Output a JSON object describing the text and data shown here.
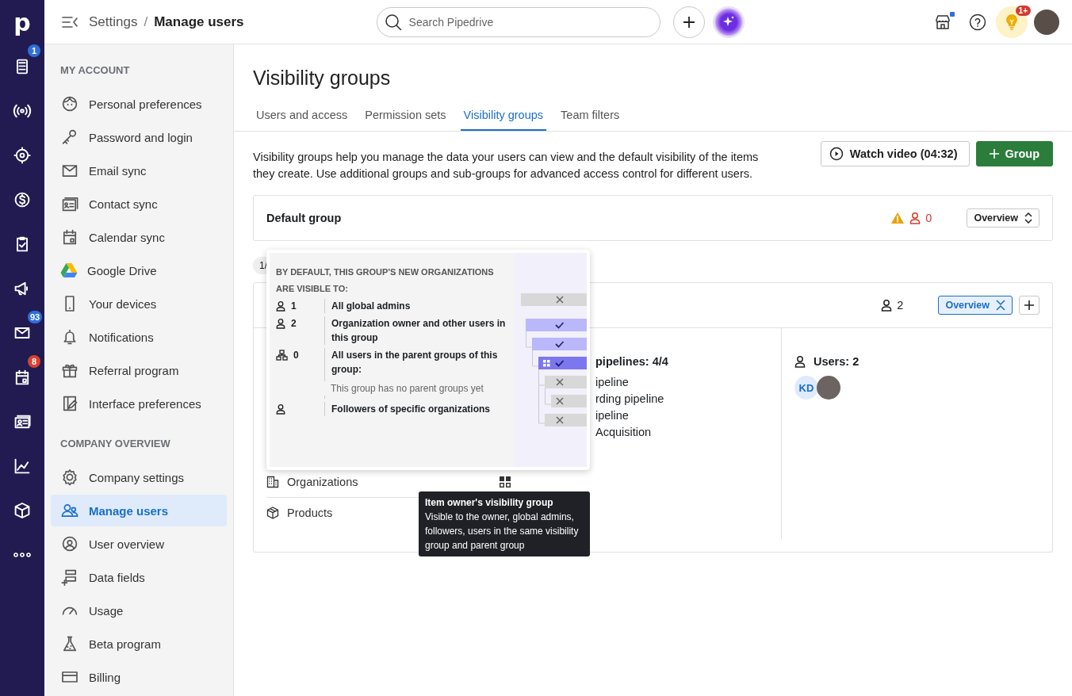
{
  "nav_rail": {
    "logo": "p",
    "badges": [
      {
        "text": "1",
        "color": "#2f6fdb"
      },
      {
        "text": "93",
        "color": "#2f6fdb"
      },
      {
        "text": "8",
        "color": "#d9412f"
      }
    ]
  },
  "topbar": {
    "breadcrumb": "Settings",
    "separator": "/",
    "page": "Manage users",
    "search": {
      "placeholder": "Search Pipedrive"
    },
    "tips_badge": "1+"
  },
  "sidebar": {
    "sections": [
      {
        "title": "MY ACCOUNT",
        "items": [
          {
            "label": "Personal preferences",
            "selected": false
          },
          {
            "label": "Password and login",
            "selected": false
          },
          {
            "label": "Email sync",
            "selected": false
          },
          {
            "label": "Contact sync",
            "selected": false
          },
          {
            "label": "Calendar sync",
            "selected": false
          },
          {
            "label": "Google Drive",
            "selected": false
          },
          {
            "label": "Your devices",
            "selected": false
          },
          {
            "label": "Notifications",
            "selected": false
          },
          {
            "label": "Referral program",
            "selected": false
          },
          {
            "label": "Interface preferences",
            "selected": false
          }
        ]
      },
      {
        "title": "COMPANY OVERVIEW",
        "items": [
          {
            "label": "Company settings",
            "selected": false
          },
          {
            "label": "Manage users",
            "selected": true
          },
          {
            "label": "User overview",
            "selected": false
          },
          {
            "label": "Data fields",
            "selected": false
          },
          {
            "label": "Usage",
            "selected": false
          },
          {
            "label": "Beta program",
            "selected": false
          },
          {
            "label": "Billing",
            "selected": false
          }
        ]
      }
    ]
  },
  "title": "Visibility groups",
  "tabs": [
    {
      "label": "Users and access",
      "selected": false
    },
    {
      "label": "Permission sets",
      "selected": false
    },
    {
      "label": "Visibility groups",
      "selected": true
    },
    {
      "label": "Team filters",
      "selected": false
    }
  ],
  "description": "Visibility groups help you manage the data your users can view and the default visibility of the items they create. Use additional groups and sub-groups for advanced access control for different users.",
  "buttons": {
    "video": "Watch video (04:32)",
    "add_group": "Group"
  },
  "groups": [
    {
      "name": "Default group",
      "warning": true,
      "users": "0",
      "view": "Overview",
      "expanded": false
    },
    {
      "warning": false,
      "users": "2",
      "view": "Overview",
      "expanded": true
    }
  ],
  "level_tag": "1/",
  "entities": [
    {
      "label": "Organizations",
      "kind": "building",
      "owner_group_icon": true
    },
    {
      "label": "Products",
      "kind": "box",
      "owner_group_icon": false
    }
  ],
  "pipelines": {
    "heading": "pipelines: 4/4",
    "items": [
      "ipeline",
      "rding pipeline",
      "ipeline",
      "Acquisition"
    ]
  },
  "users": {
    "heading": "Users: 2",
    "avatars": [
      {
        "kind": "initials",
        "initials": "KD"
      },
      {
        "kind": "photo"
      }
    ]
  },
  "popover": {
    "heading": "BY DEFAULT, THIS GROUP'S NEW ORGANIZATIONS ARE VISIBLE TO:",
    "rows": [
      {
        "kind": "person",
        "count": "1",
        "label": "All global admins"
      },
      {
        "kind": "person",
        "count": "2",
        "label": "Organization owner and other users in this group"
      },
      {
        "kind": "hierarchy",
        "count": "0",
        "label": "All users in the parent groups of this group:",
        "note": "This group has no parent groups yet"
      },
      {
        "kind": "person",
        "label": "Followers of specific organizations"
      }
    ],
    "tree": [
      {
        "allowed": false,
        "current": false
      },
      {
        "allowed": true,
        "current": false,
        "children": [
          {
            "allowed": true,
            "current": false,
            "children": [
              {
                "allowed": true,
                "current": true,
                "children": [
                  {
                    "allowed": false,
                    "current": false,
                    "children": [
                      {
                        "allowed": false,
                        "current": false
                      }
                    ]
                  },
                  {
                    "allowed": false,
                    "current": false
                  }
                ]
              }
            ]
          }
        ]
      }
    ]
  },
  "tooltip": {
    "title": "Item owner's visibility group",
    "text": "Visible to the owner, global admins, followers, users in the same visibility group and parent group"
  }
}
